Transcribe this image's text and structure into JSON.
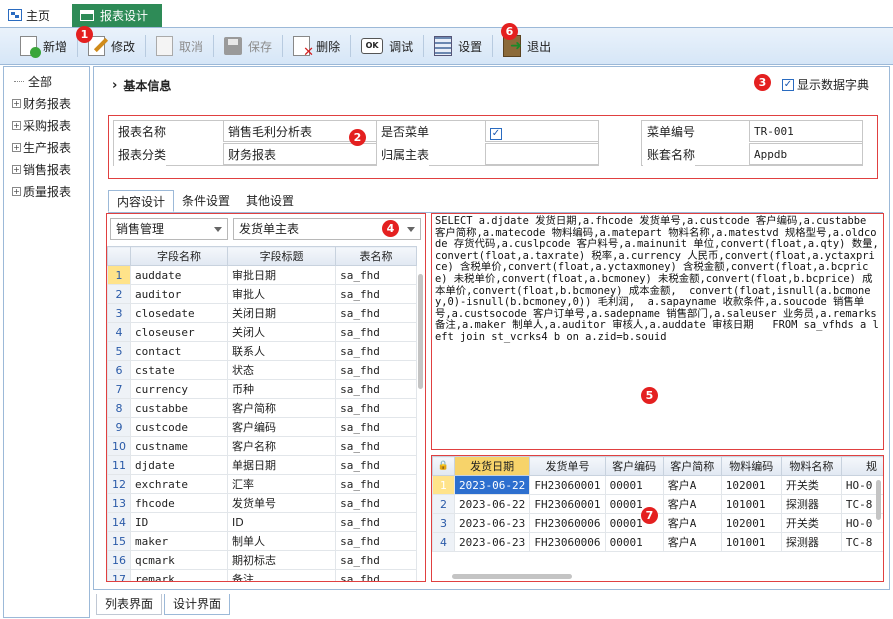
{
  "tabs": {
    "home": "主页",
    "active": "报表设计"
  },
  "toolbar": {
    "new": "新增",
    "edit": "修改",
    "cancel": "取消",
    "save": "保存",
    "delete": "删除",
    "debug": "调试",
    "debug_icon_text": "OK",
    "settings": "设置",
    "exit": "退出"
  },
  "badges": [
    "1",
    "2",
    "3",
    "4",
    "5",
    "6",
    "7"
  ],
  "tree": {
    "root": "全部",
    "items": [
      "财务报表",
      "采购报表",
      "生产报表",
      "销售报表",
      "质量报表"
    ]
  },
  "section": {
    "title": "基本信息",
    "show_dict_label": "显示数据字典",
    "show_dict_checked": true
  },
  "info": {
    "report_name_label": "报表名称",
    "report_name": "销售毛利分析表",
    "report_category_label": "报表分类",
    "report_category": "财务报表",
    "is_menu_label": "是否菜单",
    "is_menu_checked": true,
    "parent_label": "归属主表",
    "parent": "",
    "menu_code_label": "菜单编号",
    "menu_code": "TR-001",
    "account_label": "账套名称",
    "account": "Appdb"
  },
  "subtabs": [
    "内容设计",
    "条件设置",
    "其他设置"
  ],
  "field_grid": {
    "module_select": "销售管理",
    "table_select": "发货单主表",
    "columns": [
      "字段名称",
      "字段标题",
      "表名称"
    ],
    "rows": [
      [
        "auddate",
        "审批日期",
        "sa_fhd"
      ],
      [
        "auditor",
        "审批人",
        "sa_fhd"
      ],
      [
        "closedate",
        "关闭日期",
        "sa_fhd"
      ],
      [
        "closeuser",
        "关闭人",
        "sa_fhd"
      ],
      [
        "contact",
        "联系人",
        "sa_fhd"
      ],
      [
        "cstate",
        "状态",
        "sa_fhd"
      ],
      [
        "currency",
        "币种",
        "sa_fhd"
      ],
      [
        "custabbe",
        "客户简称",
        "sa_fhd"
      ],
      [
        "custcode",
        "客户编码",
        "sa_fhd"
      ],
      [
        "custname",
        "客户名称",
        "sa_fhd"
      ],
      [
        "djdate",
        "单据日期",
        "sa_fhd"
      ],
      [
        "exchrate",
        "汇率",
        "sa_fhd"
      ],
      [
        "fhcode",
        "发货单号",
        "sa_fhd"
      ],
      [
        "ID",
        "ID",
        "sa_fhd"
      ],
      [
        "maker",
        "制单人",
        "sa_fhd"
      ],
      [
        "qcmark",
        "期初标志",
        "sa_fhd"
      ],
      [
        "remark",
        "备注",
        "sa_fhd"
      ]
    ]
  },
  "sql": "SELECT a.djdate 发货日期,a.fhcode 发货单号,a.custcode 客户编码,a.custabbe 客户简称,a.matecode 物料编码,a.matepart 物料名称,a.matestvd 规格型号,a.oldcode 存货代码,a.cuslpcode 客户料号,a.mainunit 单位,convert(float,a.qty) 数量,convert(float,a.taxrate) 税率,a.currency 人民币,convert(float,a.yctaxprice) 含税单价,convert(float,a.yctaxmoney) 含税金额,convert(float,a.bcprice) 未税单价,convert(float,a.bcmoney) 未税金额,convert(float,b.bcprice) 成本单价,convert(float,b.bcmoney) 成本金额,  convert(float,isnull(a.bcmoney,0)-isnull(b.bcmoney,0)) 毛利润,  a.sapayname 收款条件,a.soucode 销售单号,a.custsocode 客户订单号,a.sadepname 销售部门,a.saleuser 业务员,a.remarks 备注,a.maker 制单人,a.auditor 审核人,a.auddate 审核日期   FROM sa_vfhds a left join st_vcrks4 b on a.zid=b.souid",
  "result_grid": {
    "columns": [
      "发货日期",
      "发货单号",
      "客户编码",
      "客户简称",
      "物料编码",
      "物料名称",
      "规"
    ],
    "rows": [
      [
        "2023-06-22",
        "FH23060001",
        "00001",
        "客户A",
        "102001",
        "开关类",
        "HO-0"
      ],
      [
        "2023-06-22",
        "FH23060001",
        "00001",
        "客户A",
        "101001",
        "探测器",
        "TC-8"
      ],
      [
        "2023-06-23",
        "FH23060006",
        "00001",
        "客户A",
        "102001",
        "开关类",
        "HO-0"
      ],
      [
        "2023-06-23",
        "FH23060006",
        "00001",
        "客户A",
        "101001",
        "探测器",
        "TC-8"
      ]
    ]
  },
  "bottom_tabs": [
    "列表界面",
    "设计界面"
  ]
}
